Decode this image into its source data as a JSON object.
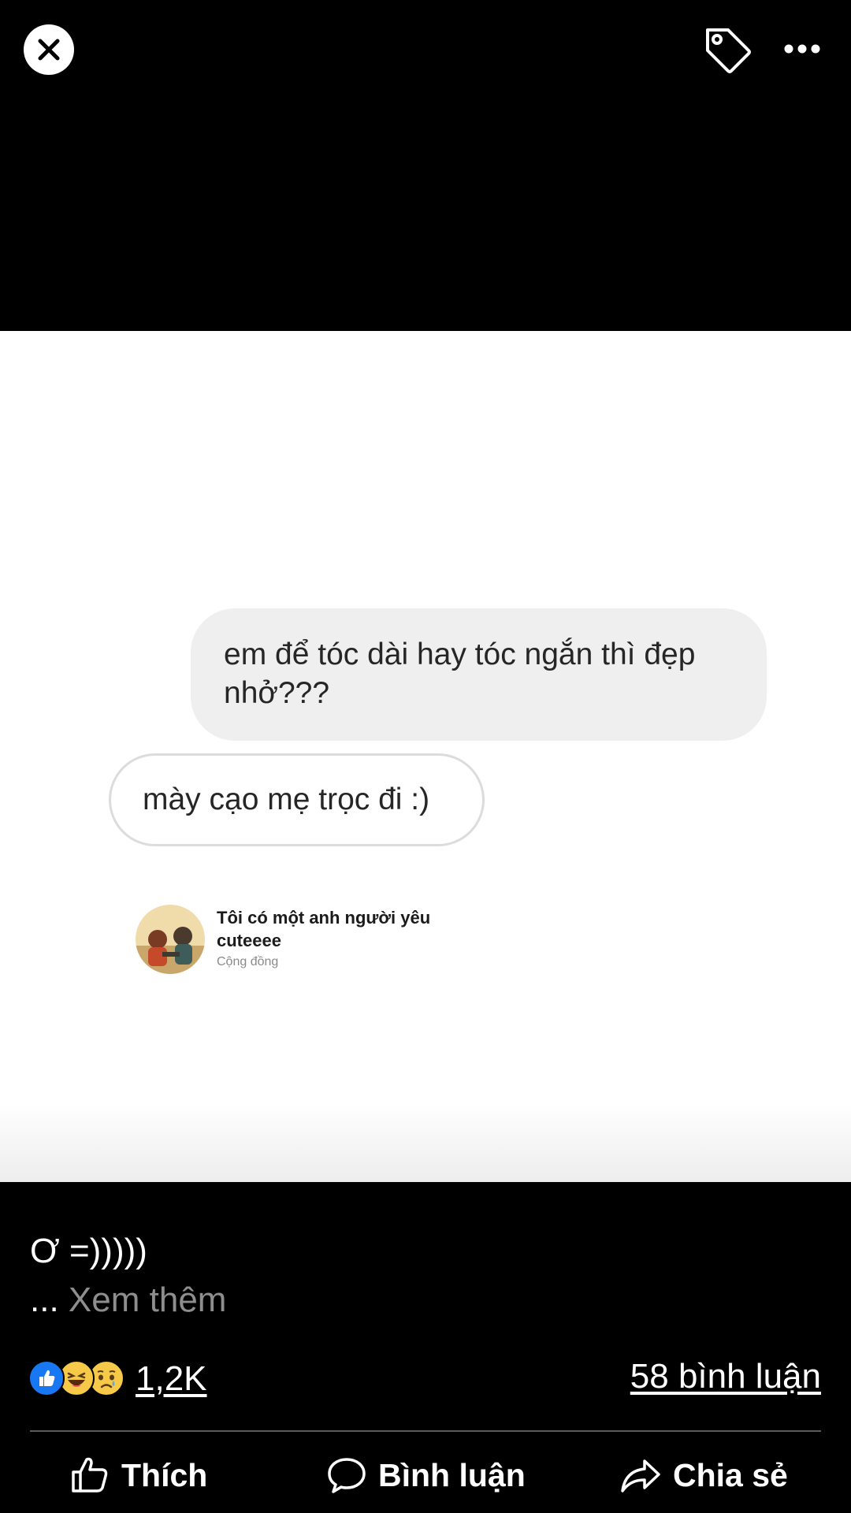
{
  "header": {
    "close_icon": "close-icon",
    "tag_icon": "tag-icon",
    "more_icon": "more-horizontal-icon"
  },
  "photo": {
    "sent_message": "em để tóc dài hay tóc ngắn thì đẹp nhở???",
    "received_message": "mày cạo mẹ trọc đi :)",
    "group": {
      "name": "Tôi có một anh người yêu cuteeee",
      "category": "Cộng đồng"
    }
  },
  "post": {
    "caption": "Ơ =)))))",
    "see_more_dots": "...",
    "see_more_label": "Xem thêm",
    "reactions": {
      "icons": [
        "like-reaction-icon",
        "haha-reaction-icon",
        "sad-reaction-icon"
      ],
      "count": "1,2K"
    },
    "comments_count": "58 bình luận"
  },
  "actions": {
    "like_label": "Thích",
    "comment_label": "Bình luận",
    "share_label": "Chia sẻ"
  },
  "colors": {
    "background": "#000000",
    "like_blue": "#1877f2",
    "reaction_yellow": "#f7c948",
    "bubble_gray": "#efefef"
  }
}
